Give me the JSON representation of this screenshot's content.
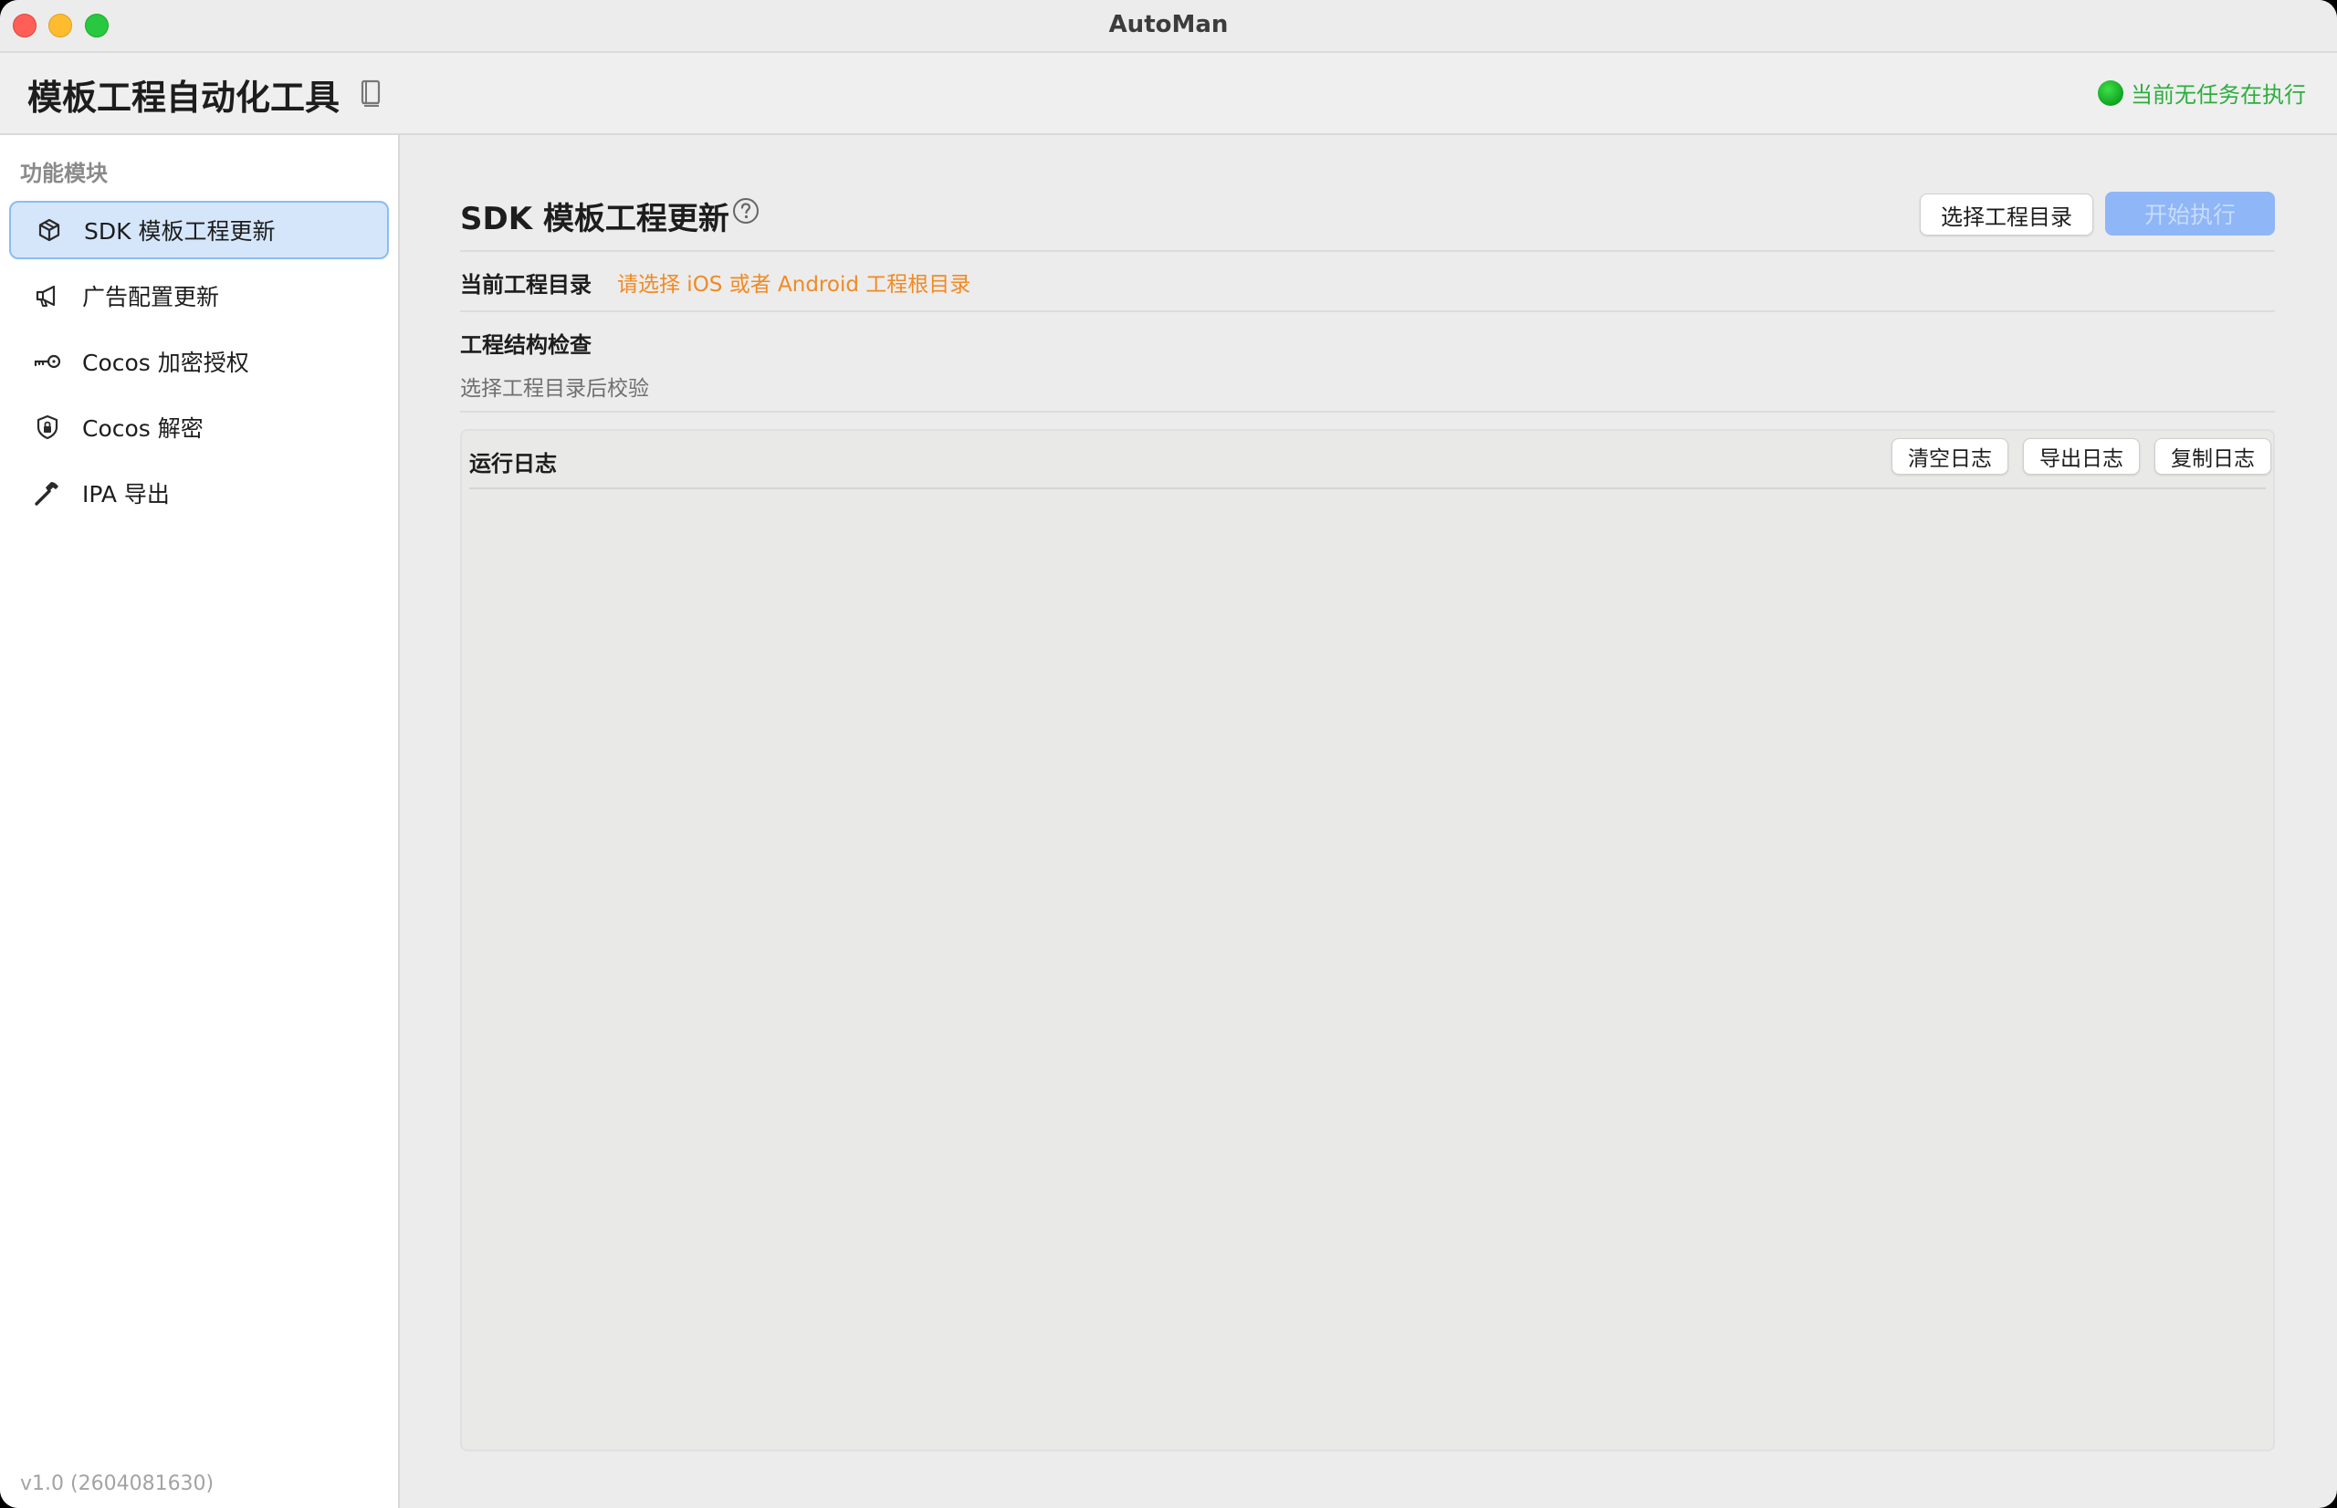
{
  "window": {
    "title": "AutoMan"
  },
  "header": {
    "app_title": "模板工程自动化工具",
    "status_text": "当前无任务在执行",
    "status_color": "#2cae3c"
  },
  "sidebar": {
    "heading": "功能模块",
    "items": [
      {
        "label": "SDK 模板工程更新",
        "icon": "cube-icon",
        "active": true
      },
      {
        "label": "广告配置更新",
        "icon": "megaphone-icon",
        "active": false
      },
      {
        "label": "Cocos 加密授权",
        "icon": "key-icon",
        "active": false
      },
      {
        "label": "Cocos 解密",
        "icon": "lock-shield-icon",
        "active": false
      },
      {
        "label": "IPA 导出",
        "icon": "hammer-icon",
        "active": false
      }
    ],
    "version": "v1.0 (2604081630)"
  },
  "main": {
    "section_title": "SDK 模板工程更新",
    "choose_dir_button": "选择工程目录",
    "start_button": "开始执行",
    "current_dir_label": "当前工程目录",
    "current_dir_hint": "请选择 iOS 或者 Android 工程根目录",
    "structure_check_label": "工程结构检查",
    "structure_check_hint": "选择工程目录后校验",
    "log": {
      "title": "运行日志",
      "clear_button": "清空日志",
      "export_button": "导出日志",
      "copy_button": "复制日志"
    }
  },
  "colors": {
    "accent": "#8fb6f7",
    "warning": "#f08a24",
    "selection_bg": "#d5e6fb"
  }
}
